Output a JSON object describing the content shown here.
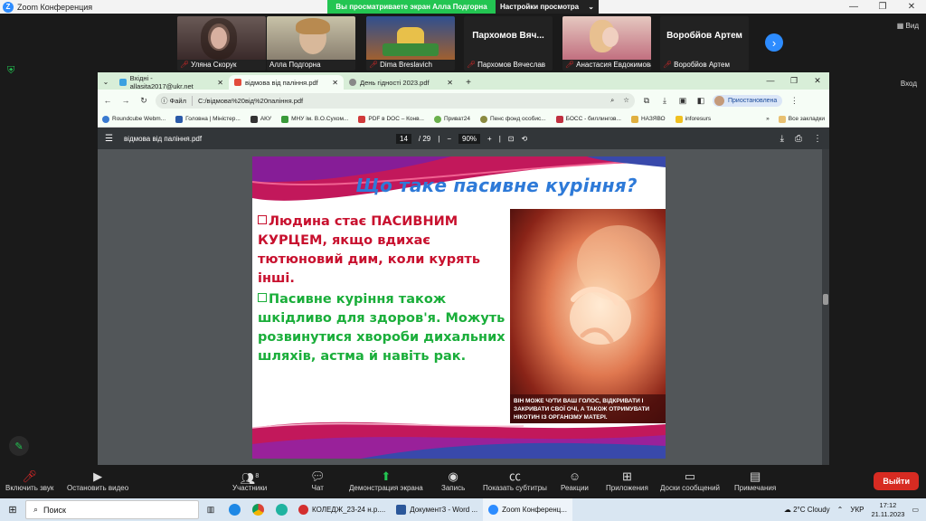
{
  "zoom": {
    "window_title": "Zoom Конференция",
    "share_banner": "Вы просматриваете экран Алла Подгорна",
    "view_options": "Настройки просмотра",
    "view_label": "Вид",
    "exit_label": "Вход",
    "participants_tiles": [
      {
        "name": "Уляна Скорук",
        "muted": true
      },
      {
        "name": "Алла Подгорна",
        "muted": false
      },
      {
        "name": "Dima Breslavich",
        "muted": true
      },
      {
        "name": "Пархомов Вячеслав",
        "big": "Пархомов Вяч...",
        "muted": true
      },
      {
        "name": "Анастасия Евдокимова",
        "muted": true
      },
      {
        "name": "Воробйов Артем",
        "big": "Воробйов Артем",
        "muted": true
      }
    ],
    "bottom_bar": {
      "audio": "Включить звук",
      "video": "Остановить видео",
      "participants": "Участники",
      "participants_count": "8",
      "chat": "Чат",
      "share": "Демонстрация экрана",
      "record": "Запись",
      "captions": "Показать субтитры",
      "reactions": "Реакции",
      "apps": "Приложения",
      "whiteboards": "Доски сообщений",
      "notes": "Примечания",
      "leave": "Выйти"
    }
  },
  "browser": {
    "tabs": [
      {
        "title": "Вхідні - allasita2017@ukr.net",
        "active": false
      },
      {
        "title": "відмова від паління.pdf",
        "active": true
      },
      {
        "title": "День гідності 2023.pdf",
        "active": false
      }
    ],
    "address": {
      "chip": "Файл",
      "url": "C:/відмова%20від%20паління.pdf"
    },
    "profile": "Приостановлена",
    "bookmarks": [
      "Roundcube Webm...",
      "Головна | Міністер...",
      "АКУ",
      "МНУ ім. В.О.Сухом...",
      "PDF в DOC – Конв...",
      "Приват24",
      "Пенс фонд особис...",
      "БОСС - биллингов...",
      "НАЗЯВО",
      "inforesurs"
    ],
    "all_bookmarks": "Все закладки"
  },
  "pdf": {
    "filename": "відмова від паління.pdf",
    "page_current": "14",
    "page_total": "/ 29",
    "zoom": "90%"
  },
  "slide": {
    "title": "Що таке пасивне куріння?",
    "bullet_1": "Людина стає ПАСИВНИМ КУРЦЕМ, якщо вдихає тютюновий дим, коли курять інші.",
    "bullet_2": "Пасивне куріння також шкідливо для здоров'я. Можуть розвинутися хвороби дихальних шляхів, астма й навіть рак.",
    "caption": "ВІН МОЖЕ ЧУТИ ВАШ ГОЛОС, ВІДКРИВАТИ І ЗАКРИВАТИ СВОЇ ОЧІ, А ТАКОЖ ОТРИМУВАТИ НІКОТИН ІЗ ОРГАНІЗМУ МАТЕРІ."
  },
  "taskbar": {
    "search": "Поиск",
    "apps": [
      {
        "label": "КОЛЕДЖ_23-24 н.р...."
      },
      {
        "label": "Документ3 - Word ..."
      },
      {
        "label": "Zoom Конференц..."
      }
    ],
    "weather": "2°C Cloudy",
    "language": "УКР",
    "time": "17:12",
    "date": "21.11.2023"
  }
}
